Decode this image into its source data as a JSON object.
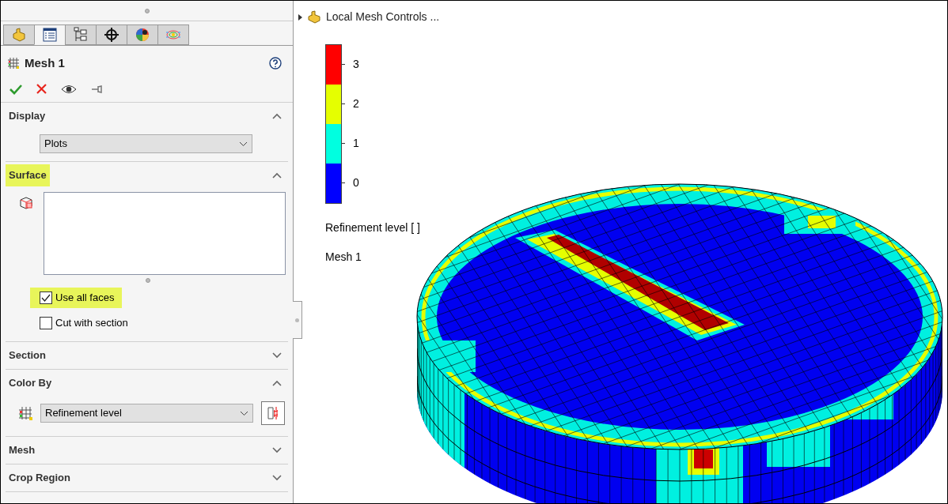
{
  "panel": {
    "tabs": [
      {
        "selected": false
      },
      {
        "selected": true
      },
      {
        "selected": false
      },
      {
        "selected": false
      },
      {
        "selected": false
      },
      {
        "selected": false
      }
    ],
    "title": "Mesh 1",
    "sections": [
      {
        "kind": "dropdown",
        "title": "Display",
        "expanded": true,
        "highlighted": false,
        "value": "Plots"
      },
      {
        "kind": "surface",
        "title": "Surface",
        "expanded": true,
        "highlighted": true,
        "options": [
          {
            "label": "Use all faces",
            "checked": true,
            "highlighted": true
          },
          {
            "label": "Cut with section",
            "checked": false,
            "highlighted": false
          }
        ]
      },
      {
        "kind": "empty",
        "title": "Section",
        "expanded": false,
        "highlighted": false
      },
      {
        "kind": "colorby",
        "title": "Color By",
        "expanded": true,
        "highlighted": false,
        "value": "Refinement level"
      },
      {
        "kind": "empty",
        "title": "Mesh",
        "expanded": false,
        "highlighted": false
      },
      {
        "kind": "empty",
        "title": "Crop Region",
        "expanded": false,
        "highlighted": false
      }
    ]
  },
  "viewport": {
    "tree_item": "Local Mesh Controls ...",
    "legend": {
      "levels": [
        {
          "label": "3",
          "color": "#ff0000"
        },
        {
          "label": "2",
          "color": "#e5ff00"
        },
        {
          "label": "1",
          "color": "#00ffe0"
        },
        {
          "label": "0",
          "color": "#0000ff"
        }
      ],
      "title": "Refinement level [ ]",
      "subtitle": "Mesh 1"
    }
  }
}
